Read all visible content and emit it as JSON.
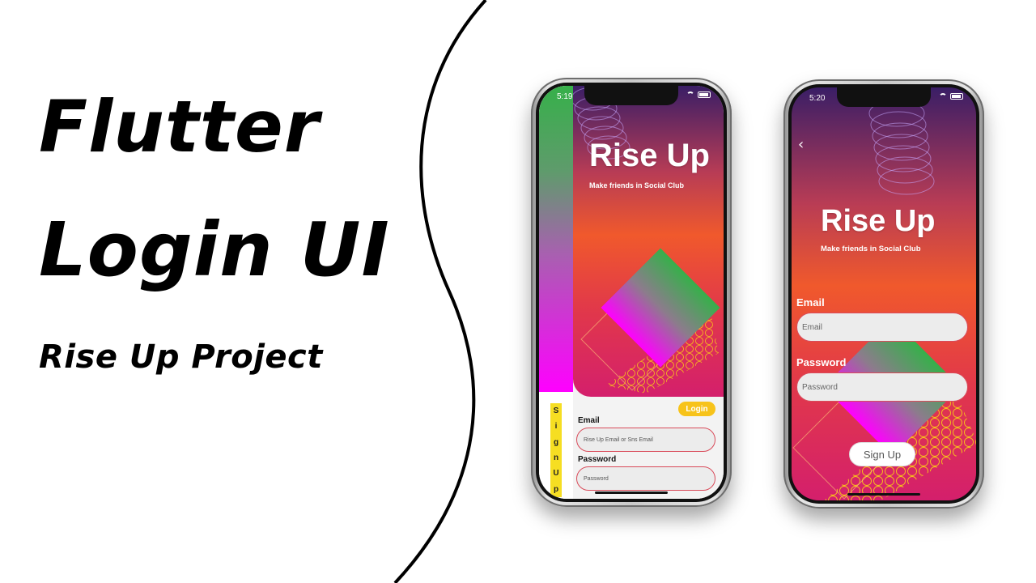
{
  "headline": {
    "line1": "Flutter",
    "line2": "Login UI",
    "subtitle": "Rise Up Project"
  },
  "phone1": {
    "time": "5:19",
    "app_title": "Rise Up",
    "app_subtitle": "Make friends in Social Club",
    "side_tab_letters": [
      "S",
      "i",
      "g",
      "n",
      "U",
      "p"
    ],
    "login_button": "Login",
    "email_label": "Email",
    "email_placeholder": "Rise Up Email or Sns Email",
    "password_label": "Password",
    "password_placeholder": "Password"
  },
  "phone2": {
    "time": "5:20",
    "back_icon": "chevron-left-icon",
    "app_title": "Rise Up",
    "app_subtitle": "Make friends in Social Club",
    "email_label": "Email",
    "email_placeholder": "Email",
    "password_label": "Password",
    "password_placeholder": "Password",
    "signup_button": "Sign Up"
  },
  "colors": {
    "accent_yellow": "#f7c31a",
    "gradient_top": "#3a1e66",
    "gradient_mid": "#f0592c",
    "gradient_bottom": "#d41f6c",
    "green": "#36b04a",
    "magenta": "#ff00ff"
  }
}
